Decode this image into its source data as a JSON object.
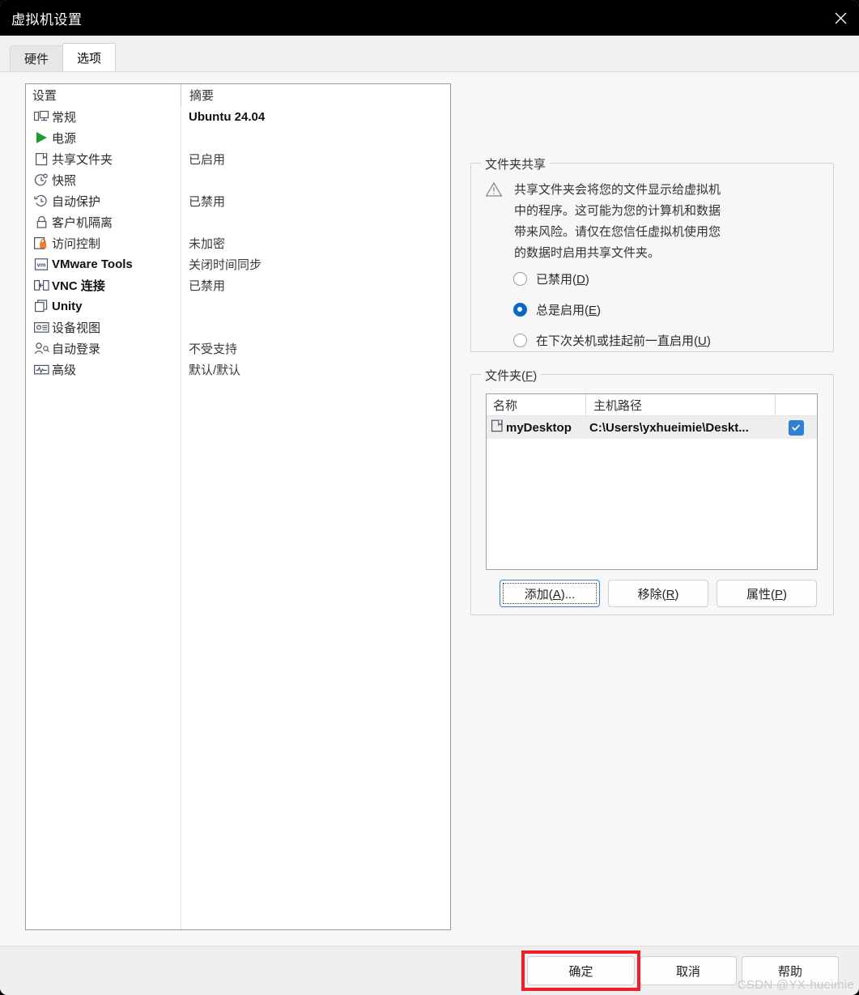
{
  "window": {
    "title": "虚拟机设置",
    "close_icon": "close-icon"
  },
  "tabs": [
    {
      "label": "硬件",
      "active": false
    },
    {
      "label": "选项",
      "active": true
    }
  ],
  "settings_list": {
    "columns": [
      "设置",
      "摘要"
    ],
    "rows": [
      {
        "icon": "monitor-icon",
        "name": "常规",
        "summary": "Ubuntu 24.04",
        "bold": true
      },
      {
        "icon": "play-icon",
        "name": "电源",
        "summary": ""
      },
      {
        "icon": "folder-icon",
        "name": "共享文件夹",
        "summary": "已启用"
      },
      {
        "icon": "snapshot-icon",
        "name": "快照",
        "summary": ""
      },
      {
        "icon": "autoprotect-icon",
        "name": "自动保护",
        "summary": "已禁用"
      },
      {
        "icon": "lock-icon",
        "name": "客户机隔离",
        "summary": ""
      },
      {
        "icon": "access-lock-icon",
        "name": "访问控制",
        "summary": "未加密"
      },
      {
        "icon": "vmware-tools-icon",
        "name": "VMware Tools",
        "summary": "关闭时间同步",
        "name_bold": true
      },
      {
        "icon": "vnc-icon",
        "name": "VNC 连接",
        "summary": "已禁用",
        "name_bold": true
      },
      {
        "icon": "unity-icon",
        "name": "Unity",
        "summary": "",
        "name_bold": true
      },
      {
        "icon": "device-view-icon",
        "name": "设备视图",
        "summary": ""
      },
      {
        "icon": "autologon-icon",
        "name": "自动登录",
        "summary": "不受支持"
      },
      {
        "icon": "advanced-icon",
        "name": "高级",
        "summary": "默认/默认"
      }
    ]
  },
  "sharing": {
    "legend": "文件夹共享",
    "warning_icon": "warning-triangle-icon",
    "warning_lines": [
      "共享文件夹会将您的文件显示给虚拟机",
      "中的程序。这可能为您的计算机和数据",
      "带来风险。请仅在您信任虚拟机使用您",
      "的数据时启用共享文件夹。"
    ],
    "options": [
      {
        "label": "已禁用",
        "mnemonic": "D",
        "checked": false
      },
      {
        "label": "总是启用",
        "mnemonic": "E",
        "checked": true
      },
      {
        "label": "在下次关机或挂起前一直启用",
        "mnemonic": "U",
        "checked": false
      }
    ]
  },
  "folders": {
    "legend": "文件夹",
    "legend_mnemonic": "F",
    "columns": [
      "名称",
      "主机路径",
      ""
    ],
    "rows": [
      {
        "icon": "folder-icon",
        "name": "myDesktop",
        "host_path": "C:\\Users\\yxhueimie\\Deskt...",
        "enabled": true,
        "check_icon": "check-icon"
      }
    ],
    "buttons": [
      {
        "label": "添加",
        "mnemonic": "A",
        "suffix": "...",
        "focused": true
      },
      {
        "label": "移除",
        "mnemonic": "R",
        "suffix": "",
        "focused": false
      },
      {
        "label": "属性",
        "mnemonic": "P",
        "suffix": "",
        "focused": false
      }
    ]
  },
  "footer": {
    "ok_label": "确定",
    "cancel_label": "取消",
    "help_label": "帮助",
    "highlight_color": "#ef1f23",
    "watermark": "CSDN @YX-hueimie"
  }
}
